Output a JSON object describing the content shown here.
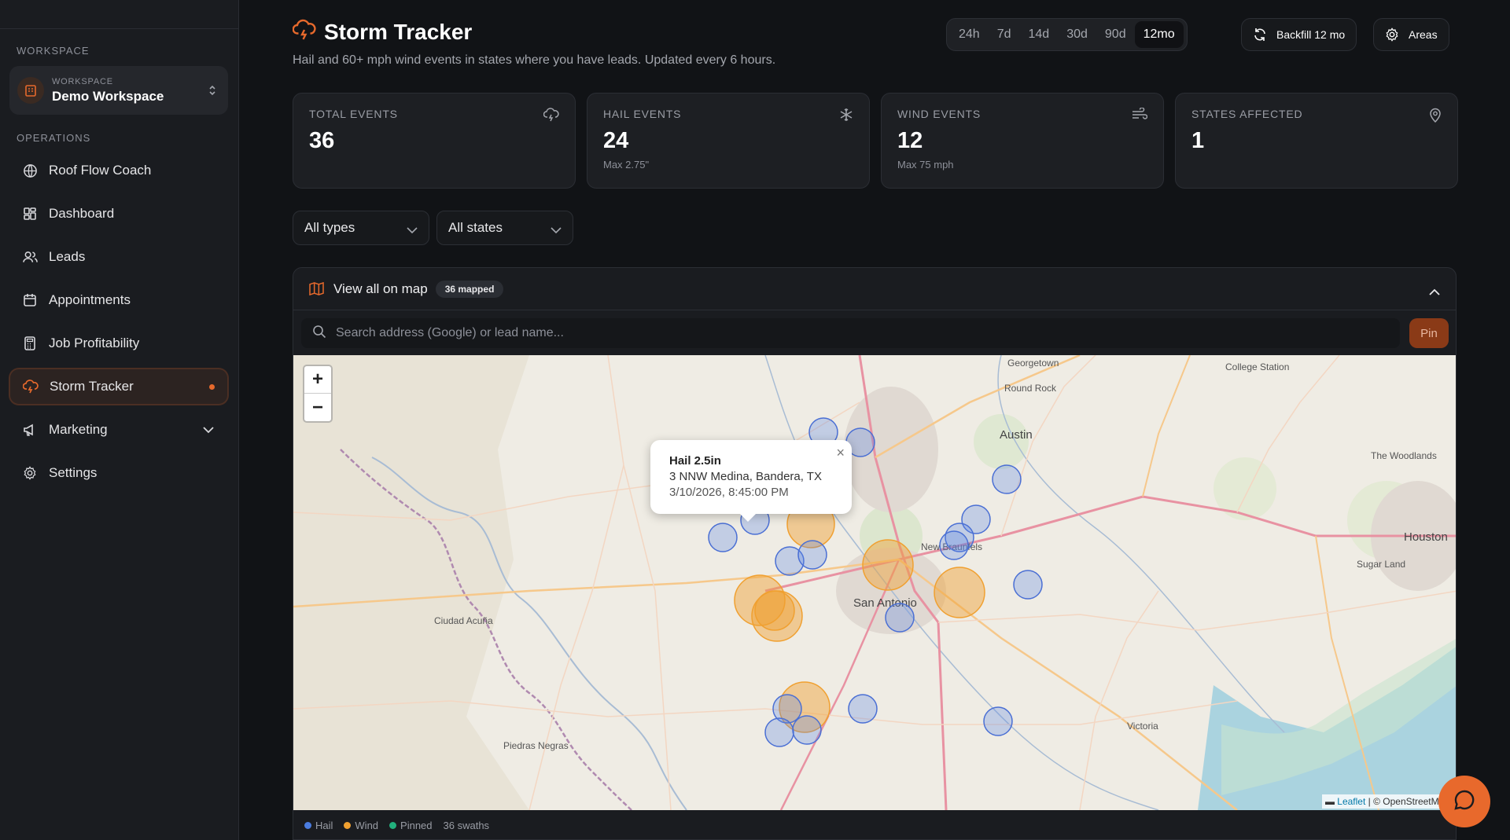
{
  "sidebar": {
    "workspace_section": "WORKSPACE",
    "workspace_card": {
      "label": "WORKSPACE",
      "name": "Demo Workspace"
    },
    "operations_section": "OPERATIONS",
    "items": [
      {
        "label": "Roof Flow Coach",
        "icon": "globe-icon"
      },
      {
        "label": "Dashboard",
        "icon": "dashboard-icon"
      },
      {
        "label": "Leads",
        "icon": "users-icon"
      },
      {
        "label": "Appointments",
        "icon": "calendar-icon"
      },
      {
        "label": "Job Profitability",
        "icon": "calculator-icon"
      },
      {
        "label": "Storm Tracker",
        "icon": "storm-icon",
        "active": true
      },
      {
        "label": "Marketing",
        "icon": "megaphone-icon"
      },
      {
        "label": "Settings",
        "icon": "gear-icon"
      }
    ]
  },
  "header": {
    "title": "Storm Tracker",
    "subtitle": "Hail and 60+ mph wind events in states where you have leads. Updated every 6 hours.",
    "ranges": [
      "24h",
      "7d",
      "14d",
      "30d",
      "90d",
      "12mo"
    ],
    "active_range": "12mo",
    "backfill_label": "Backfill 12 mo",
    "areas_label": "Areas"
  },
  "stats": [
    {
      "label": "TOTAL EVENTS",
      "value": "36",
      "sub": "",
      "icon": "storm-icon"
    },
    {
      "label": "HAIL EVENTS",
      "value": "24",
      "sub": "Max 2.75\"",
      "icon": "snowflake-icon"
    },
    {
      "label": "WIND EVENTS",
      "value": "12",
      "sub": "Max 75 mph",
      "icon": "wind-icon"
    },
    {
      "label": "STATES AFFECTED",
      "value": "1",
      "sub": "",
      "icon": "map-pin-icon"
    }
  ],
  "filters": {
    "type": "All types",
    "state": "All states"
  },
  "map": {
    "header_label": "View all on map",
    "mapped_badge": "36 mapped",
    "search_placeholder": "Search address (Google) or lead name...",
    "pin_label": "Pin",
    "popup": {
      "title": "Hail 2.5in",
      "location": "3 NNW Medina, Bandera, TX",
      "date": "3/10/2026, 8:45:00 PM"
    },
    "attribution_leaflet": "Leaflet",
    "attribution_rest": " | © OpenStreetMap",
    "cities": [
      "Georgetown",
      "College Station",
      "Round Rock",
      "Austin",
      "The Woodlands",
      "New Braunfels",
      "Houston",
      "Sugar Land",
      "San Antonio",
      "Ciudad Acuña",
      "Victoria",
      "Piedras Negras"
    ],
    "zoom_in": "+",
    "zoom_out": "−"
  },
  "legend": {
    "hail": "Hail",
    "wind": "Wind",
    "pinned": "Pinned",
    "swaths": "36 swaths"
  },
  "colors": {
    "accent": "#e6692c",
    "hail": "#5b86e5",
    "wind": "#f0a030",
    "pinned": "#22b07d"
  }
}
